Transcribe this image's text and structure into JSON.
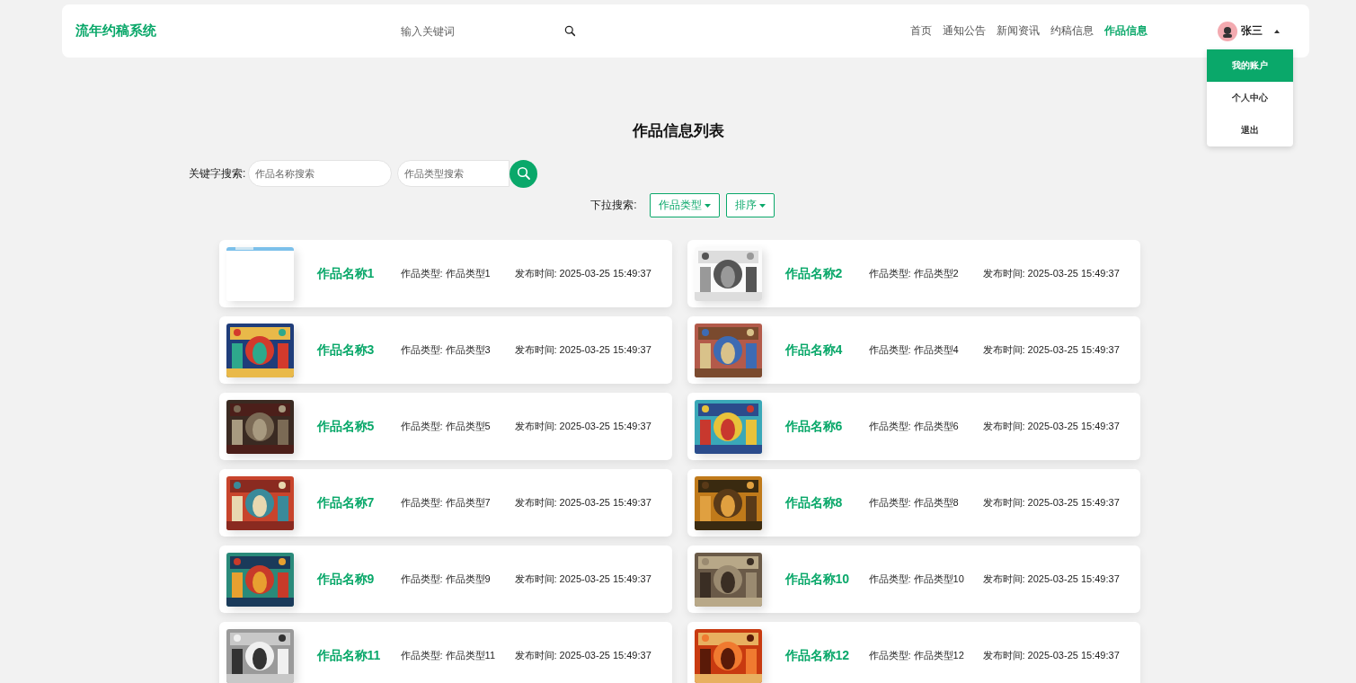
{
  "header": {
    "logo": "流年约稿系统",
    "search": {
      "placeholder": "输入关键词"
    },
    "nav": [
      {
        "label": "首页",
        "selected": false
      },
      {
        "label": "通知公告",
        "selected": false
      },
      {
        "label": "新闻资讯",
        "selected": false
      },
      {
        "label": "约稿信息",
        "selected": false
      },
      {
        "label": "作品信息",
        "selected": true
      }
    ],
    "user": {
      "name": "张三",
      "menu": [
        {
          "label": "我的账户",
          "selected": true
        },
        {
          "label": "个人中心",
          "selected": false
        },
        {
          "label": "退出",
          "selected": false
        }
      ]
    }
  },
  "title": "作品信息列表",
  "filters": {
    "keyword_label": "关键字搜索:",
    "name_search": {
      "placeholder": "作品名称搜索"
    },
    "type_search": {
      "placeholder": "作品类型搜索"
    },
    "dropdown_label": "下拉搜索:",
    "dropdowns": [
      "作品类型",
      "排序"
    ]
  },
  "works": [
    {
      "name": "作品名称1",
      "type": "作品类型: 作品类型1",
      "time": "发布时间: 2025-03-25 15:49:37"
    },
    {
      "name": "作品名称2",
      "type": "作品类型: 作品类型2",
      "time": "发布时间: 2025-03-25 15:49:37"
    },
    {
      "name": "作品名称3",
      "type": "作品类型: 作品类型3",
      "time": "发布时间: 2025-03-25 15:49:37"
    },
    {
      "name": "作品名称4",
      "type": "作品类型: 作品类型4",
      "time": "发布时间: 2025-03-25 15:49:37"
    },
    {
      "name": "作品名称5",
      "type": "作品类型: 作品类型5",
      "time": "发布时间: 2025-03-25 15:49:37"
    },
    {
      "name": "作品名称6",
      "type": "作品类型: 作品类型6",
      "time": "发布时间: 2025-03-25 15:49:37"
    },
    {
      "name": "作品名称7",
      "type": "作品类型: 作品类型7",
      "time": "发布时间: 2025-03-25 15:49:37"
    },
    {
      "name": "作品名称8",
      "type": "作品类型: 作品类型8",
      "time": "发布时间: 2025-03-25 15:49:37"
    },
    {
      "name": "作品名称9",
      "type": "作品类型: 作品类型9",
      "time": "发布时间: 2025-03-25 15:49:37"
    },
    {
      "name": "作品名称10",
      "type": "作品类型: 作品类型10",
      "time": "发布时间: 2025-03-25 15:49:37"
    },
    {
      "name": "作品名称11",
      "type": "作品类型: 作品类型11",
      "time": "发布时间: 2025-03-25 15:49:37"
    },
    {
      "name": "作品名称12",
      "type": "作品类型: 作品类型12",
      "time": "发布时间: 2025-03-25 15:49:37"
    }
  ]
}
